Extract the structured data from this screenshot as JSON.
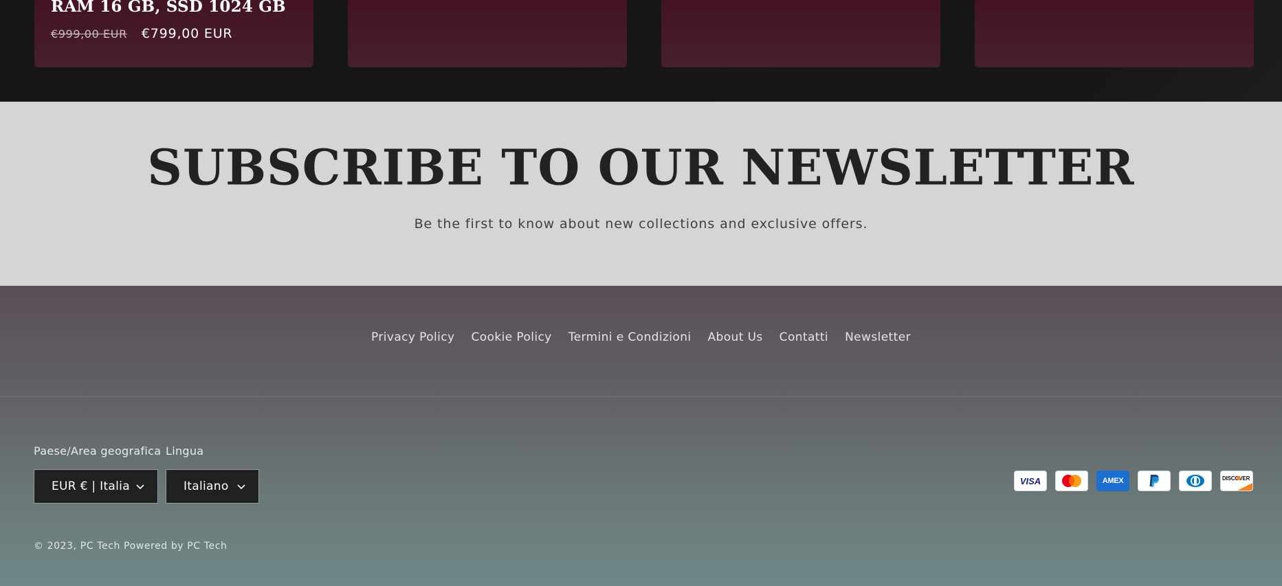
{
  "products": {
    "cards": [
      {
        "title": "RAM 16 GB, SSD 1024 GB",
        "price_old": "€999,00 EUR",
        "price_new": "€799,00 EUR"
      },
      {
        "title": ""
      },
      {
        "title": ""
      },
      {
        "title": ""
      }
    ]
  },
  "newsletter": {
    "title": "SUBSCRIBE TO OUR NEWSLETTER",
    "subtitle": "Be the first to know about new collections and exclusive offers."
  },
  "footer": {
    "links": [
      "Privacy Policy",
      "Cookie Policy",
      "Termini e Condizioni",
      "About Us",
      "Contatti",
      "Newsletter"
    ],
    "country_label": "Paese/Area geografica",
    "country_value": "EUR € | Italia",
    "language_label": "Lingua",
    "language_value": "Italiano",
    "payment_icons": [
      "visa-icon",
      "mastercard-icon",
      "amex-icon",
      "paypal-icon",
      "diners-club-icon",
      "discover-icon"
    ],
    "payment_text": {
      "visa": "VISA",
      "amex": "AMEX",
      "discover": "DISCOVER"
    },
    "copyright": "© 2023, PC Tech Powered by PC Tech"
  },
  "colors": {
    "card_accent": "#441323",
    "newsletter_bg": "#d5d5d5",
    "footer_top": "#5a4e58",
    "footer_bottom": "#6f8787"
  }
}
